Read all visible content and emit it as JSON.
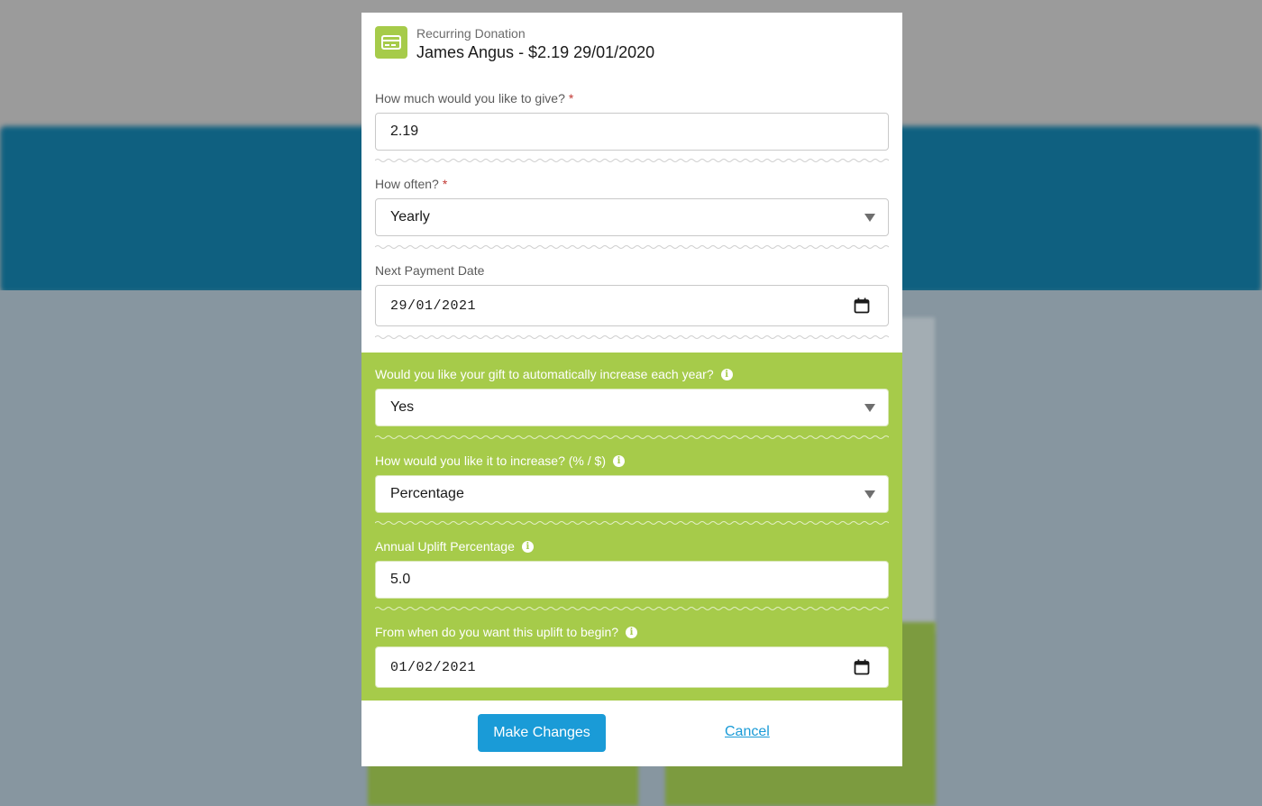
{
  "header": {
    "subtitle": "Recurring Donation",
    "title": "James Angus - $2.19 29/01/2020",
    "icon": "credit-card-icon"
  },
  "fields": {
    "amount": {
      "label": "How much would you like to give?",
      "required": "*",
      "value": "2.19"
    },
    "frequency": {
      "label": "How often?",
      "required": "*",
      "value": "Yearly"
    },
    "next_payment": {
      "label": "Next Payment Date",
      "value": "29/01/2021"
    }
  },
  "uplift": {
    "auto_increase": {
      "label": "Would you like your gift to automatically increase each year?",
      "value": "Yes"
    },
    "increase_type": {
      "label": "How would you like it to increase? (% / $)",
      "value": "Percentage"
    },
    "percentage": {
      "label": "Annual Uplift Percentage",
      "value": "5.0"
    },
    "start_date": {
      "label": "From when do you want this uplift to begin?",
      "value": "01/02/2021"
    },
    "info_glyph": "i"
  },
  "actions": {
    "submit": "Make Changes",
    "cancel": "Cancel"
  },
  "colors": {
    "accent_green": "#a6cb4a",
    "button_blue": "#1a9bd7",
    "required_red": "#c23934"
  }
}
